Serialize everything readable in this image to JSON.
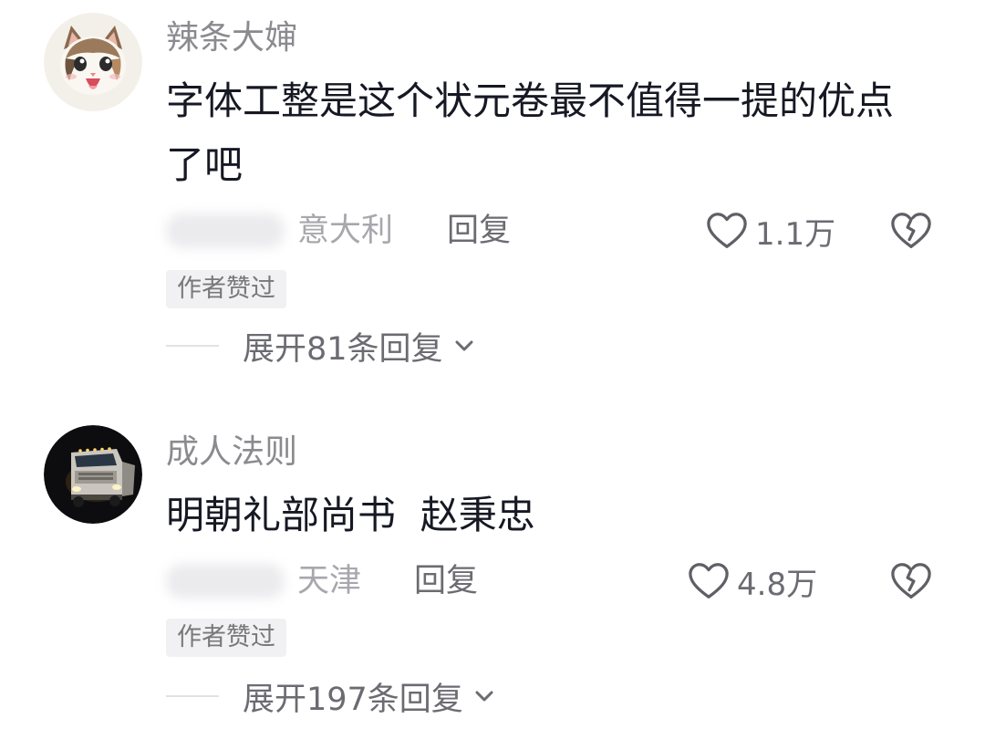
{
  "comments": [
    {
      "username": "辣条大婶",
      "avatar_icon": "cat-avatar-icon",
      "text": "字体工整是这个状元卷最不值得一提的优点了吧",
      "location": "意大利",
      "reply_label": "回复",
      "like_count": "1.1万",
      "author_badge": "作者赞过",
      "expand_label": "展开81条回复"
    },
    {
      "username": "成人法则",
      "avatar_icon": "truck-avatar-icon",
      "text": "明朝礼部尚书  赵秉忠",
      "location": "天津",
      "reply_label": "回复",
      "like_count": "4.8万",
      "author_badge": "作者赞过",
      "expand_label": "展开197条回复"
    }
  ],
  "colors": {
    "username": "#8a8a8f",
    "text": "#161823",
    "secondary": "#6b6b72",
    "location": "#a7a7ad",
    "badge_bg": "#f1f1f3"
  }
}
